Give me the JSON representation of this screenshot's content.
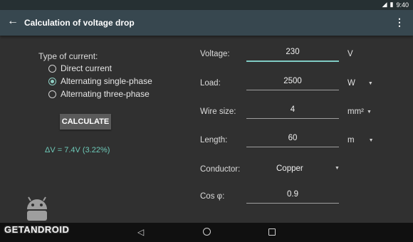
{
  "status_bar": {
    "time": "9:40"
  },
  "app_bar": {
    "title": "Calculation of voltage drop"
  },
  "current_type": {
    "label": "Type of current:",
    "options": [
      "Direct current",
      "Alternating single-phase",
      "Alternating three-phase"
    ],
    "selected": "Alternating single-phase"
  },
  "calculate_label": "CALCULATE",
  "result": "ΔV = 7.4V  (3.22%)",
  "fields": {
    "voltage": {
      "label": "Voltage:",
      "value": "230",
      "unit": "V"
    },
    "load": {
      "label": "Load:",
      "value": "2500",
      "unit": "W"
    },
    "wire_size": {
      "label": "Wire size:",
      "value": "4",
      "unit": "mm²"
    },
    "length": {
      "label": "Length:",
      "value": "60",
      "unit": "m"
    },
    "conductor": {
      "label": "Conductor:",
      "value": "Copper"
    },
    "cos_phi": {
      "label": "Cos φ:",
      "value": "0.9"
    }
  },
  "watermark": "GETANDROID",
  "colors": {
    "accent": "#80cbc4",
    "app_bar": "#37474f",
    "result_text": "#6ec9b8"
  }
}
